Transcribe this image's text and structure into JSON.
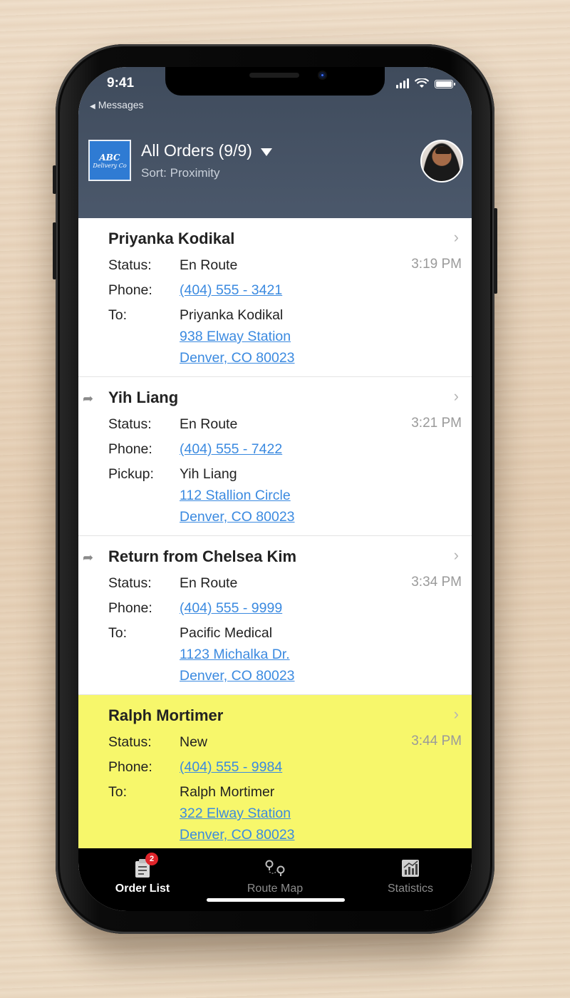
{
  "status_bar": {
    "time": "9:41",
    "back_label": "Messages"
  },
  "header": {
    "logo_line1": "ABC",
    "logo_line2": "Delivery Co",
    "title": "All Orders (9/9)",
    "sort": "Sort: Proximity"
  },
  "orders": [
    {
      "name": "Priyanka Kodikal",
      "status_label": "Status:",
      "status": "En Route",
      "time": "3:19 PM",
      "phone_label": "Phone:",
      "phone": "(404) 555 - 3421",
      "dest_label": "To:",
      "dest_name": "Priyanka Kodikal",
      "address1": "938 Elway Station",
      "address2": "Denver, CO 80023",
      "return_icon": false,
      "highlight": false
    },
    {
      "name": "Yih Liang",
      "status_label": "Status:",
      "status": "En Route",
      "time": "3:21 PM",
      "phone_label": "Phone:",
      "phone": "(404) 555 - 7422",
      "dest_label": "Pickup:",
      "dest_name": "Yih Liang",
      "address1": "112 Stallion Circle",
      "address2": "Denver, CO 80023",
      "return_icon": true,
      "highlight": false
    },
    {
      "name": "Return from Chelsea Kim",
      "status_label": "Status:",
      "status": "En Route",
      "time": "3:34 PM",
      "phone_label": "Phone:",
      "phone": "(404) 555 - 9999",
      "dest_label": "To:",
      "dest_name": "Pacific Medical",
      "address1": "1123 Michalka Dr.",
      "address2": "Denver, CO 80023",
      "return_icon": true,
      "highlight": false
    },
    {
      "name": "Ralph Mortimer",
      "status_label": "Status:",
      "status": "New",
      "time": "3:44 PM",
      "phone_label": "Phone:",
      "phone": "(404) 555 - 9984",
      "dest_label": "To:",
      "dest_name": "Ralph Mortimer",
      "address1": "322 Elway Station",
      "address2": "Denver, CO 80023",
      "return_icon": false,
      "highlight": true
    }
  ],
  "tabbar": {
    "tabs": [
      {
        "label": "Order List",
        "icon": "clipboard-icon",
        "badge": "2",
        "active": true
      },
      {
        "label": "Route Map",
        "icon": "route-pins-icon",
        "active": false
      },
      {
        "label": "Statistics",
        "icon": "statistics-icon",
        "active": false
      }
    ]
  },
  "colors": {
    "header_bg": "#4b586b",
    "link": "#3b8ae0",
    "highlight": "#f7f76b",
    "badge": "#e0242a",
    "logo_bg": "#2f7bd3"
  }
}
